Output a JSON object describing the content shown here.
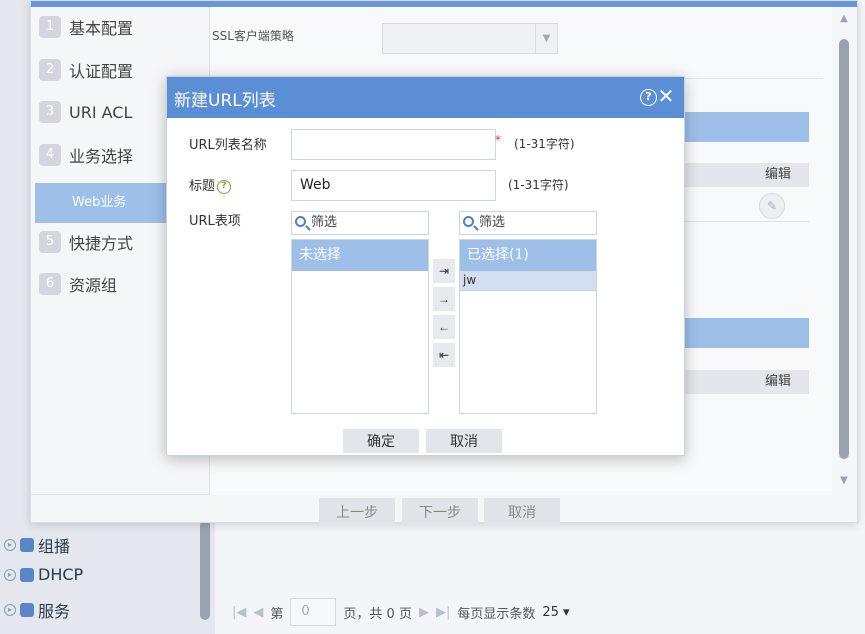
{
  "background": {
    "nav_items": [
      {
        "label": "组播",
        "icon": "multicast-icon"
      },
      {
        "label": "DHCP",
        "icon": "dhcp-icon"
      },
      {
        "label": "服务",
        "icon": "service-icon"
      }
    ],
    "pager": {
      "first_icon": "first-page-icon",
      "prev_icon": "prev-page-icon",
      "page_prefix": "第",
      "page_value": "0",
      "page_suffix": "页，共 0 页",
      "next_icon": "next-page-icon",
      "last_icon": "last-page-icon",
      "per_page_label": "每页显示条数",
      "per_page_value": "25"
    }
  },
  "wizard": {
    "steps": [
      {
        "num": "1",
        "label": "基本配置"
      },
      {
        "num": "2",
        "label": "认证配置"
      },
      {
        "num": "3",
        "label": "URI ACL"
      },
      {
        "num": "4",
        "label": "业务选择"
      },
      {
        "num": "5",
        "label": "快捷方式"
      },
      {
        "num": "6",
        "label": "资源组"
      }
    ],
    "sub_step": "Web业务",
    "ssl_label": "SSL客户端策略",
    "ssl_value": "",
    "edit_header_1": "编辑",
    "edit_header_2": "编辑",
    "buttons": {
      "prev": "上一步",
      "next": "下一步",
      "cancel": "取消"
    }
  },
  "modal": {
    "title": "新建URL列表",
    "help_icon": "help-icon",
    "close_icon": "close-icon",
    "name_label": "URL列表名称",
    "name_value": "",
    "name_required": "*",
    "name_hint": "(1-31字符)",
    "title_label": "标题",
    "title_value": "Web",
    "title_hint": "(1-31字符)",
    "items_label": "URL表项",
    "filter_placeholder": "筛选",
    "unselected_header": "未选择",
    "selected_header": "已选择(1)",
    "selected_items": [
      "jw"
    ],
    "move_buttons": [
      "⇥",
      "→",
      "←",
      "⇤"
    ],
    "ok": "确定",
    "cancel": "取消"
  },
  "colors": {
    "accent": "#5a8fd6",
    "list_header": "#9dbfe8",
    "selected_row": "#d3dff0"
  }
}
